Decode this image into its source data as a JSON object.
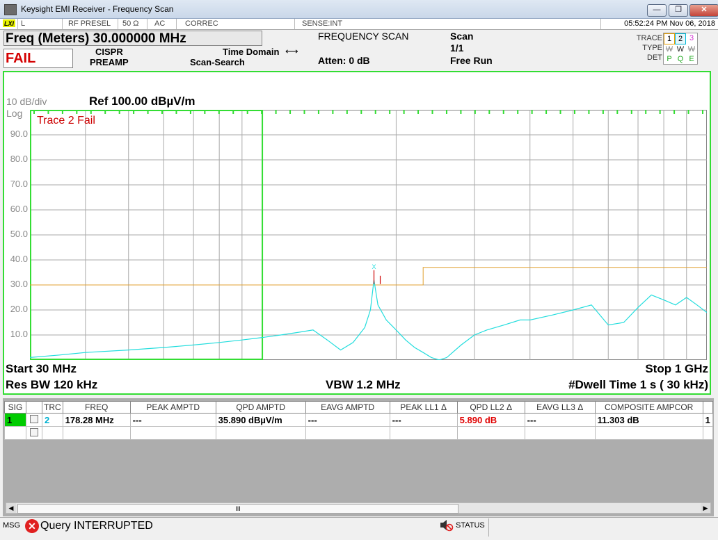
{
  "window": {
    "title": "Keysight EMI Receiver - Frequency Scan",
    "min_label": "—",
    "max_label": "❐",
    "close_label": "✕"
  },
  "strip": {
    "mode": "L",
    "rf_presel": "RF PRESEL",
    "impedance": "50 Ω",
    "coupling": "AC",
    "correc": "CORREC",
    "sense": "SENSE:INT",
    "datetime": "05:52:24 PM Nov 06, 2018"
  },
  "meas_bar": {
    "freq_readout": "Freq (Meters) 30.000000 MHz",
    "fail": "FAIL",
    "cispr": "CISPR",
    "preamp": "PREAMP",
    "time_domain": "Time Domain",
    "scan_search": "Scan-Search",
    "frequency_scan": "FREQUENCY SCAN",
    "atten": "Atten: 0 dB",
    "scan": "Scan",
    "scan_count": "1/1",
    "run_mode": "Free Run",
    "trace_label": "TRACE",
    "type_label": "TYPE",
    "det_label": "DET",
    "trace_nums": [
      "1",
      "2",
      "3"
    ],
    "type_vals": [
      "W",
      "W",
      "W"
    ],
    "det_vals": [
      "P",
      "Q",
      "E"
    ],
    "trace_colors": [
      "#e8a000",
      "#00b8d8",
      "#d030d0"
    ]
  },
  "graph": {
    "scale": "10 dB/div",
    "ref": "Ref 100.00 dBµV/m",
    "log": "Log",
    "trace_fail": "Trace 2 Fail",
    "y_ticks": [
      "90.0",
      "80.0",
      "70.0",
      "60.0",
      "50.0",
      "40.0",
      "30.0",
      "20.0",
      "10.0"
    ],
    "start": "Start 30 MHz",
    "stop": "Stop 1 GHz",
    "res_bw": "Res BW 120 kHz",
    "vbw": "VBW 1.2 MHz",
    "dwell": "#Dwell Time 1 s ( 30 kHz)",
    "marker_label": "X",
    "colors": {
      "trace": "#22dddd",
      "limit": "#e0a030",
      "frame": "#33dd33",
      "marker": "#cc0000"
    }
  },
  "chart_data": {
    "type": "line",
    "x_scale": "log",
    "xlim": [
      30,
      1000
    ],
    "ylim": [
      0,
      100
    ],
    "x_unit": "MHz",
    "y_unit": "dBµV/m",
    "limit_line": {
      "x": [
        30,
        230,
        230,
        1000
      ],
      "y": [
        30,
        30,
        37,
        37
      ]
    },
    "trace": {
      "x": [
        30,
        35,
        40,
        50,
        60,
        70,
        80,
        90,
        100,
        110,
        120,
        130,
        140,
        150,
        160,
        170,
        175,
        178.28,
        182,
        190,
        200,
        210,
        220,
        230,
        240,
        250,
        260,
        280,
        300,
        320,
        350,
        380,
        400,
        450,
        500,
        550,
        600,
        650,
        700,
        750,
        800,
        850,
        900,
        950,
        1000
      ],
      "y": [
        1,
        2,
        3,
        4,
        5,
        6,
        7,
        8,
        9,
        10,
        11,
        12,
        8,
        4,
        7,
        13,
        20,
        32,
        22,
        16,
        12,
        8,
        5,
        3,
        1,
        0,
        1,
        6,
        10,
        12,
        14,
        16,
        16,
        18,
        20,
        22,
        14,
        15,
        21,
        26,
        24,
        22,
        25,
        22,
        19
      ]
    },
    "marker": {
      "x": 178.28,
      "y": 35.89
    }
  },
  "table": {
    "headers": [
      "SIG",
      "",
      "TRC",
      "FREQ",
      "PEAK AMPTD",
      "QPD AMPTD",
      "EAVG AMPTD",
      "PEAK LL1 Δ",
      "QPD LL2 Δ",
      "EAVG LL3 Δ",
      "COMPOSITE AMPCOR"
    ],
    "row1": {
      "sig": "1",
      "trc": "2",
      "freq": "178.28 MHz",
      "peak_amptd": "---",
      "qpd_amptd": "35.890 dBµV/m",
      "eavg_amptd": "---",
      "peak_ll1": "---",
      "qpd_ll2": "5.890 dB",
      "eavg_ll3": "---",
      "composite": "11.303 dB",
      "trailing": "1"
    },
    "scroll_grip": "III"
  },
  "status": {
    "msg_label": "MSG",
    "message": "Query INTERRUPTED",
    "status_label": "STATUS"
  }
}
